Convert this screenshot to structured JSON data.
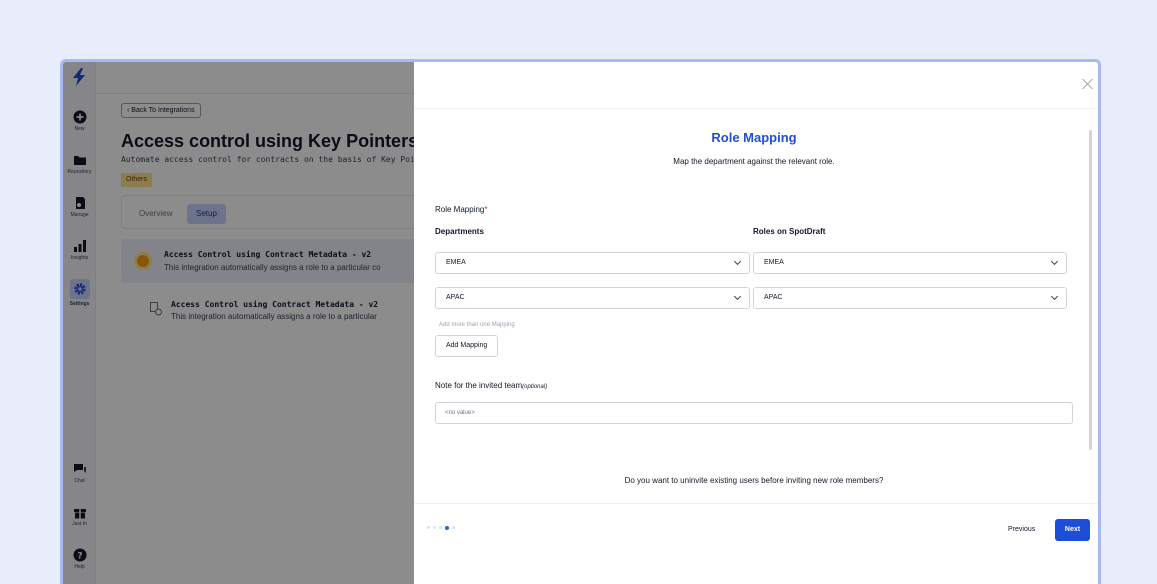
{
  "colors": {
    "accent": "#1d4ed8",
    "frame": "#a9b8f0",
    "overlay": "rgba(0,0,0,0.45)",
    "active_nav": "#c7d2fe"
  },
  "sidebar": {
    "items": [
      {
        "label": "New",
        "icon": "plus-circle-icon"
      },
      {
        "label": "Repository",
        "icon": "folder-icon"
      },
      {
        "label": "Manage",
        "icon": "manage-icon"
      },
      {
        "label": "Insights",
        "icon": "bar-chart-icon"
      },
      {
        "label": "Settings",
        "icon": "gear-icon"
      },
      {
        "label": "Chat",
        "icon": "chat-icon"
      },
      {
        "label": "Just In",
        "icon": "gift-icon"
      },
      {
        "label": "Help",
        "icon": "help-icon"
      }
    ]
  },
  "page": {
    "back_label": "Back To Integrations",
    "title": "Access control using Key Pointers",
    "subtitle": "Automate access control for contracts on the basis of Key Pointer v",
    "tag": "Others",
    "tabs": [
      "Overview",
      "Setup"
    ],
    "cards": [
      {
        "title": "Access Control using Contract Metadata - v2",
        "desc": "This integration automatically assigns a role to a particular co"
      },
      {
        "title": "Access Control using Contract Metadata - v2",
        "desc": "This integration automatically assigns a role to a particular"
      }
    ]
  },
  "drawer": {
    "title": "Role Mapping",
    "subtitle": "Map the department against the relevant role.",
    "field_label": "Role Mapping",
    "required_mark": "*",
    "col_departments": "Departments",
    "col_roles": "Roles on SpotDraft",
    "rows": [
      {
        "department": "EMEA",
        "role": "EMEA"
      },
      {
        "department": "APAC",
        "role": "APAC"
      }
    ],
    "hint": "Add more than one Mapping",
    "add_mapping": "Add Mapping",
    "note_label": "Note for the invited team",
    "note_optional": "(optional)",
    "note_value": "<no value>",
    "question": "Do you want to uninvite existing users before inviting new role members?",
    "step_total": 5,
    "step_current": 4,
    "previous": "Previous",
    "next": "Next"
  }
}
